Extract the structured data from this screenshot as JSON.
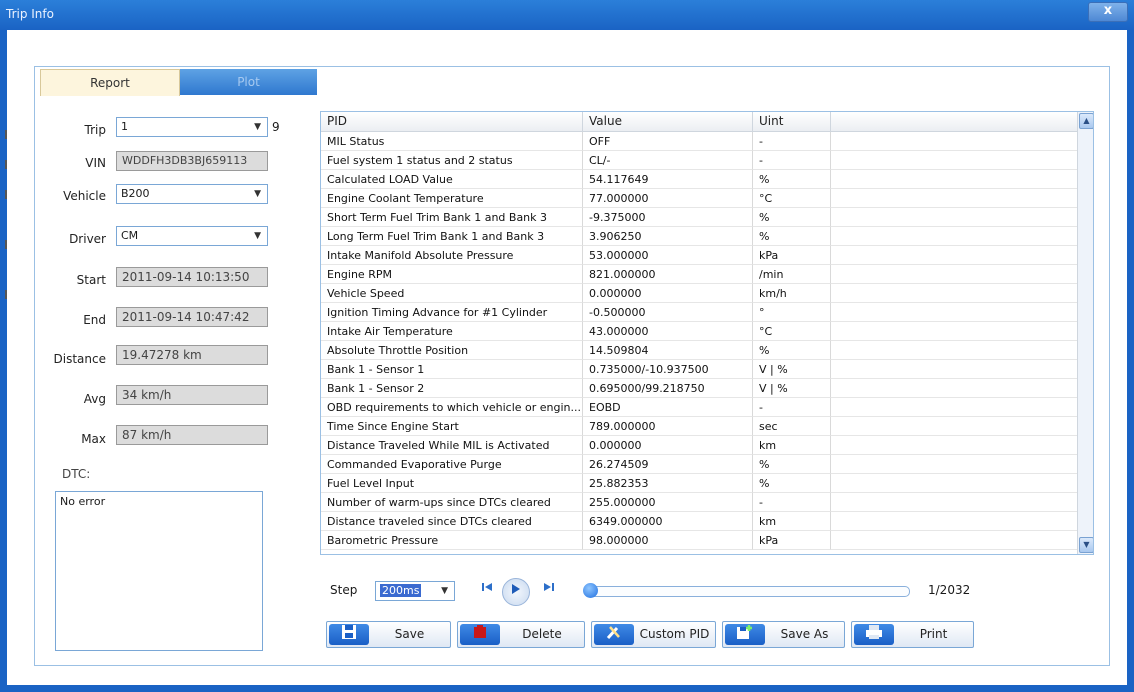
{
  "window": {
    "title": "Trip Info",
    "close": "x"
  },
  "tabs": {
    "report": "Report",
    "plot": "Plot"
  },
  "form": {
    "trip_label": "Trip",
    "trip_value": "1",
    "trip_count": "9",
    "vin_label": "VIN",
    "vin_value": "WDDFH3DB3BJ659113",
    "vehicle_label": "Vehicle",
    "vehicle_value": "B200",
    "driver_label": "Driver",
    "driver_value": "CM",
    "start_label": "Start",
    "start_value": "2011-09-14 10:13:50",
    "end_label": "End",
    "end_value": "2011-09-14 10:47:42",
    "distance_label": "Distance",
    "distance_value": "19.47278 km",
    "avg_label": "Avg",
    "avg_value": "34 km/h",
    "max_label": "Max",
    "max_value": "87 km/h",
    "dtc_label": "DTC:",
    "dtc_value": "No error"
  },
  "grid": {
    "columns": [
      "PID",
      "Value",
      "Uint"
    ],
    "rows": [
      [
        "MIL Status",
        "OFF",
        "-"
      ],
      [
        "Fuel system 1 status and 2 status",
        "CL/-",
        "-"
      ],
      [
        "Calculated LOAD Value",
        "54.117649",
        "%"
      ],
      [
        "Engine Coolant Temperature",
        "77.000000",
        "°C"
      ],
      [
        "Short Term Fuel Trim Bank 1 and Bank 3",
        "-9.375000",
        "%"
      ],
      [
        "Long Term Fuel Trim Bank 1 and Bank 3",
        "3.906250",
        "%"
      ],
      [
        "Intake Manifold Absolute Pressure",
        "53.000000",
        "kPa"
      ],
      [
        "Engine RPM",
        "821.000000",
        "/min"
      ],
      [
        "Vehicle Speed",
        "0.000000",
        "km/h"
      ],
      [
        "Ignition Timing Advance for #1 Cylinder",
        "-0.500000",
        "°"
      ],
      [
        "Intake Air Temperature",
        "43.000000",
        "°C"
      ],
      [
        "Absolute Throttle Position",
        "14.509804",
        "%"
      ],
      [
        "Bank 1 - Sensor 1",
        "0.735000/-10.937500",
        "V | %"
      ],
      [
        "Bank 1 - Sensor 2",
        "0.695000/99.218750",
        "V | %"
      ],
      [
        "OBD requirements to which vehicle or engin...",
        "EOBD",
        "-"
      ],
      [
        "Time Since Engine Start",
        "789.000000",
        "sec"
      ],
      [
        "Distance Traveled While MIL is Activated",
        "0.000000",
        "km"
      ],
      [
        "Commanded Evaporative Purge",
        "26.274509",
        "%"
      ],
      [
        "Fuel Level Input",
        "25.882353",
        "%"
      ],
      [
        "Number of warm-ups since DTCs cleared",
        "255.000000",
        "-"
      ],
      [
        "Distance traveled since DTCs cleared",
        "6349.000000",
        "km"
      ],
      [
        "Barometric Pressure",
        "98.000000",
        "kPa"
      ]
    ]
  },
  "playback": {
    "step_label": "Step",
    "step_value": "200ms",
    "first_icon": "skip-back-icon",
    "play_icon": "play-icon",
    "last_icon": "skip-forward-icon",
    "position_fraction": 0.0005,
    "counter": "1/2032"
  },
  "actions": {
    "save": "Save",
    "delete": "Delete",
    "custom_pid": "Custom PID",
    "save_as": "Save As",
    "print": "Print"
  },
  "colors": {
    "title_bar": "#1a63c4",
    "accent": "#2f78cf",
    "report_tab": "#fdf5dd",
    "delete_icon": "#c81818"
  }
}
